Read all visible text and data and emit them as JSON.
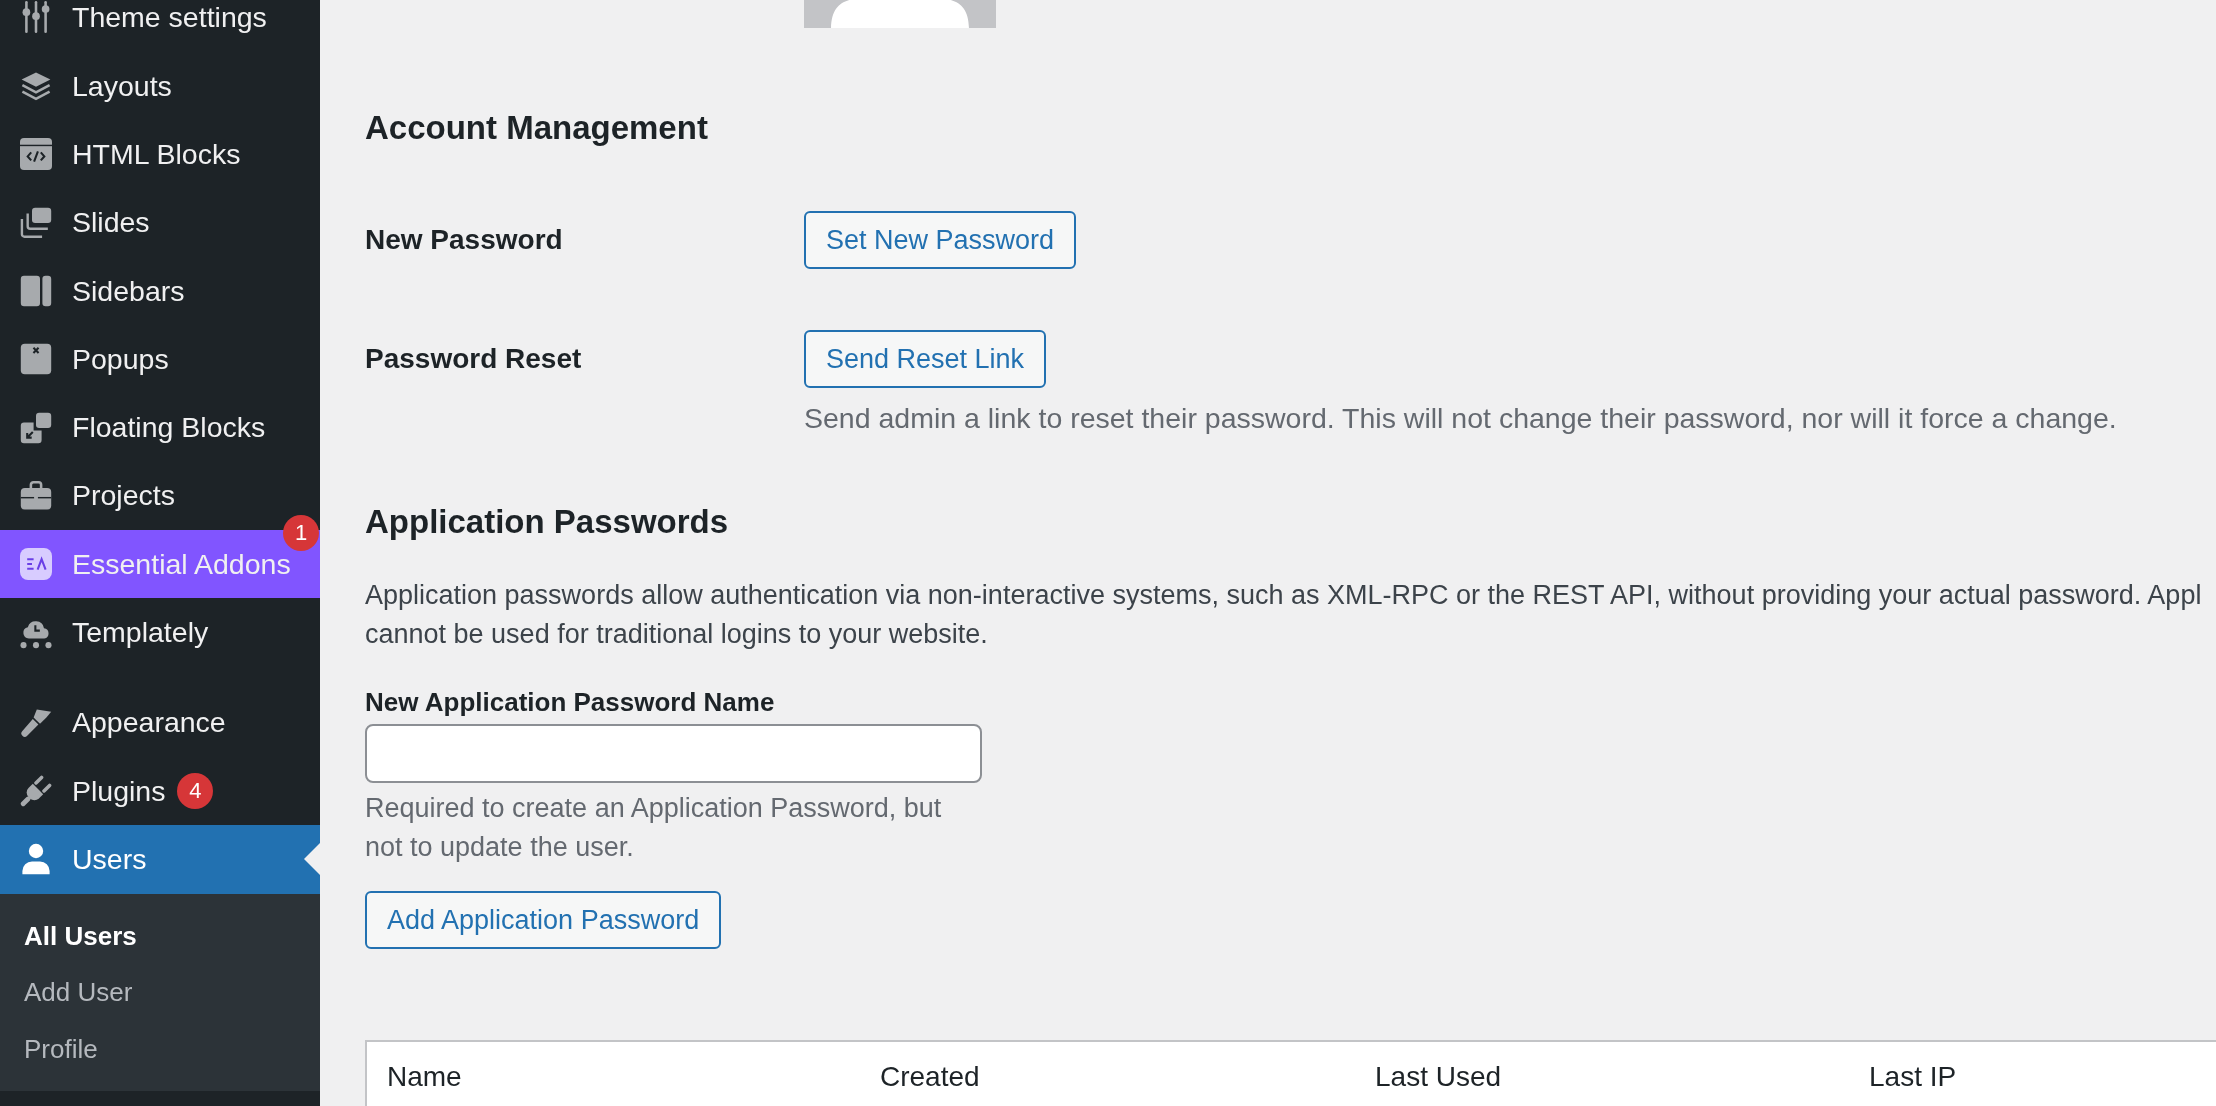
{
  "sidebar": {
    "groups": [
      {
        "items": [
          {
            "label": "Theme settings",
            "selected": false
          },
          {
            "label": "Layouts",
            "selected": false
          },
          {
            "label": "HTML Blocks",
            "selected": false
          },
          {
            "label": "Slides",
            "selected": false
          },
          {
            "label": "Sidebars",
            "selected": false
          },
          {
            "label": "Popups",
            "selected": false
          },
          {
            "label": "Floating Blocks",
            "selected": false
          },
          {
            "label": "Projects",
            "selected": false
          },
          {
            "label": "Essential Addons",
            "selected": false,
            "color": "#8155ff",
            "badge": {
              "text": "1",
              "kind": "corner"
            }
          },
          {
            "label": "Templately",
            "selected": false
          }
        ]
      },
      {
        "items": [
          {
            "label": "Appearance",
            "selected": false
          },
          {
            "label": "Plugins",
            "selected": false,
            "badge": {
              "text": "4",
              "kind": "inline"
            }
          },
          {
            "label": "Users",
            "selected": true,
            "children": [
              {
                "label": "All Users",
                "selected": true
              },
              {
                "label": "Add User",
                "selected": false
              },
              {
                "label": "Profile",
                "selected": false
              }
            ]
          }
        ]
      }
    ]
  },
  "account_management": {
    "title": "Account Management",
    "rows": [
      {
        "label": "New Password",
        "button": "Set New Password"
      },
      {
        "label": "Password Reset",
        "button": "Send Reset Link",
        "description": "Send admin a link to reset their password. This will not change their password, nor will it force a change."
      }
    ]
  },
  "application_passwords": {
    "title": "Application Passwords",
    "description_lines": [
      "Application passwords allow authentication via non-interactive systems, such as XML-RPC or the REST API, without providing your actual password. Appl",
      "cannot be used for traditional logins to your website."
    ],
    "field": {
      "label": "New Application Password Name",
      "hint": "Required to create an Application Password, but not to update the user."
    },
    "button": "Add Application Password",
    "table": {
      "columns": [
        "Name",
        "Created",
        "Last Used",
        "Last IP"
      ]
    }
  }
}
